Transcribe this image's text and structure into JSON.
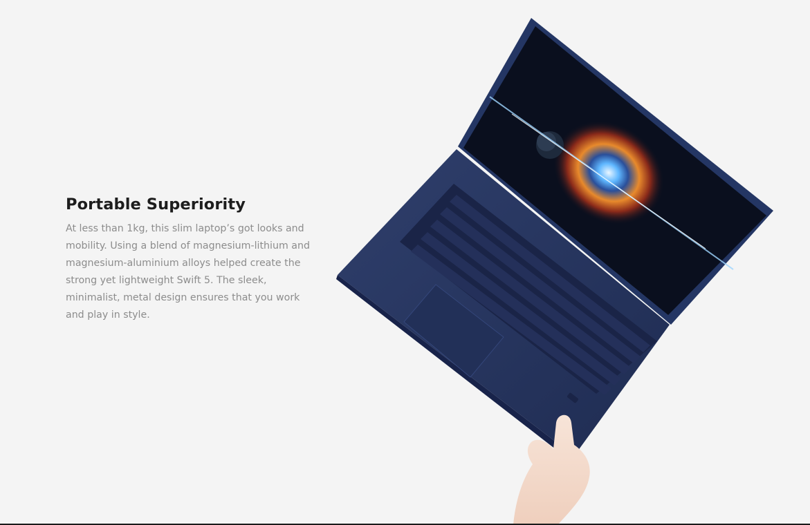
{
  "section": {
    "heading": "Portable Superiority",
    "body": "At less than 1kg, this slim laptop’s got looks and mobility. Using a blend of magnesium-lithium and magnesium-aluminium alloys helped create the strong yet lightweight Swift 5. The sleek, minimalist, metal design ensures that you work and play in style."
  },
  "hero_image": {
    "subject": "laptop-held-by-hand",
    "icon": "laptop-icon"
  },
  "colors": {
    "background": "#f4f4f4",
    "heading": "#1d1d1d",
    "body_text": "#8c8c8c",
    "laptop_body": "#26355e",
    "screen": "#0a1020"
  }
}
